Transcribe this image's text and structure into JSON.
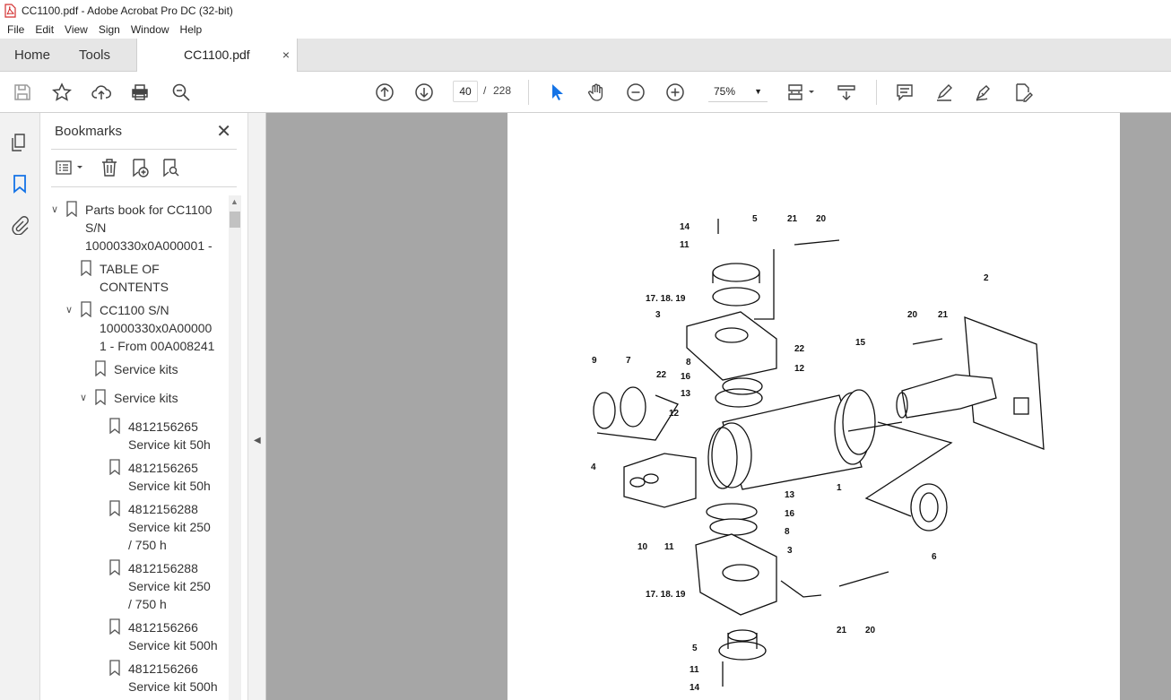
{
  "window": {
    "title": "CC1100.pdf - Adobe Acrobat Pro DC (32-bit)"
  },
  "menu": [
    "File",
    "Edit",
    "View",
    "Sign",
    "Window",
    "Help"
  ],
  "tabs": {
    "home": "Home",
    "tools": "Tools",
    "document": "CC1100.pdf",
    "close_glyph": "×"
  },
  "toolbar": {
    "current_page": "40",
    "separator": "/",
    "total_pages": "228",
    "zoom": "75%"
  },
  "bookmarks": {
    "title": "Bookmarks",
    "items": [
      {
        "label": "Parts book for CC1100\nS/N\n10000330x0A000001 -",
        "expanded": true
      },
      {
        "label": "TABLE OF\nCONTENTS"
      },
      {
        "label": "CC1100 S/N\n10000330x0A00000\n1 - From 00A008241",
        "expanded": true
      },
      {
        "label": "Service kits"
      },
      {
        "label": "Service kits",
        "expanded": true
      },
      {
        "label": "4812156265\nService kit 50h"
      },
      {
        "label": "4812156265\nService kit 50h"
      },
      {
        "label": "4812156288\nService kit 250\n/ 750 h"
      },
      {
        "label": "4812156288\nService kit 250\n/ 750 h"
      },
      {
        "label": "4812156266\nService kit 500h"
      },
      {
        "label": "4812156266\nService kit 500h"
      }
    ]
  },
  "drawing": {
    "callouts": [
      "14",
      "5",
      "21",
      "20",
      "11",
      "17. 18. 19",
      "3",
      "2",
      "20",
      "21",
      "22",
      "12",
      "15",
      "9",
      "7",
      "8",
      "16",
      "22",
      "13",
      "12",
      "4",
      "1",
      "13",
      "16",
      "8",
      "10",
      "11",
      "3",
      "6",
      "17. 18. 19",
      "21",
      "20",
      "5",
      "11",
      "14"
    ]
  }
}
